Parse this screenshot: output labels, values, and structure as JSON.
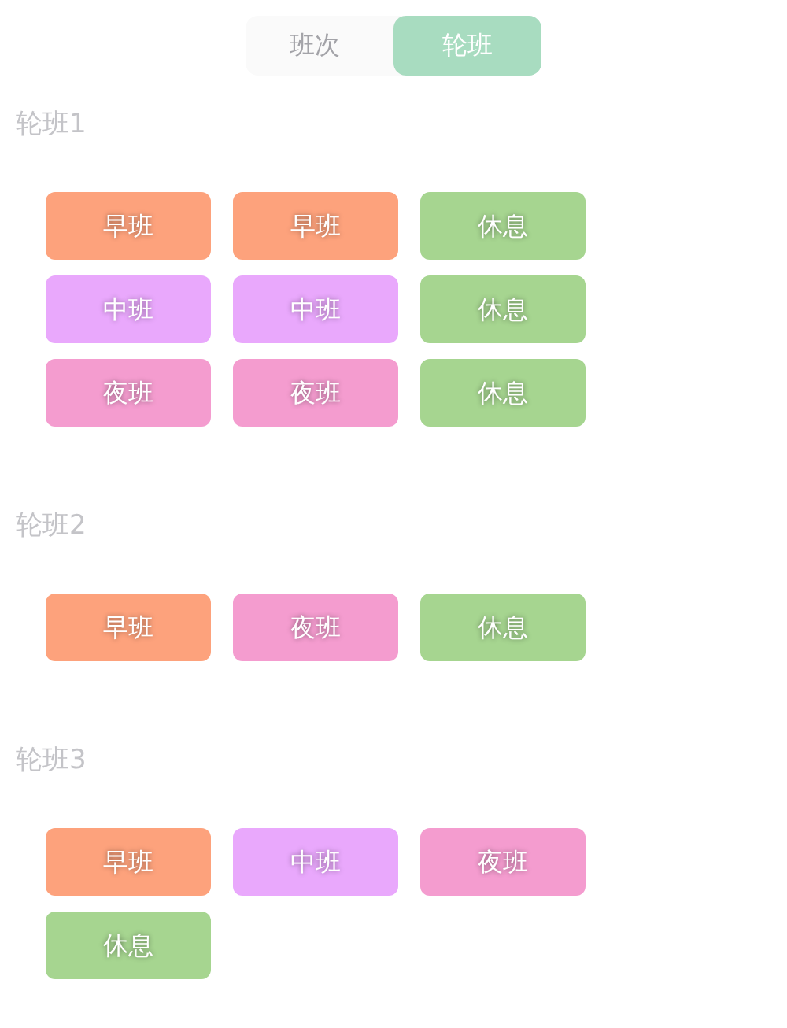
{
  "tabs": [
    {
      "label": "班次",
      "selected": false
    },
    {
      "label": "轮班",
      "selected": true
    }
  ],
  "rotations": [
    {
      "title": "轮班1",
      "shifts": [
        {
          "label": "早班",
          "color": "#fda27c"
        },
        {
          "label": "早班",
          "color": "#fda27c"
        },
        {
          "label": "休息",
          "color": "#a6d590"
        },
        {
          "label": "中班",
          "color": "#e9a8fc"
        },
        {
          "label": "中班",
          "color": "#e9a8fc"
        },
        {
          "label": "休息",
          "color": "#a6d590"
        },
        {
          "label": "夜班",
          "color": "#f49ccf"
        },
        {
          "label": "夜班",
          "color": "#f49ccf"
        },
        {
          "label": "休息",
          "color": "#a6d590"
        }
      ]
    },
    {
      "title": "轮班2",
      "shifts": [
        {
          "label": "早班",
          "color": "#fda27c"
        },
        {
          "label": "夜班",
          "color": "#f49ccf"
        },
        {
          "label": "休息",
          "color": "#a6d590"
        }
      ]
    },
    {
      "title": "轮班3",
      "shifts": [
        {
          "label": "早班",
          "color": "#fda27c"
        },
        {
          "label": "中班",
          "color": "#e9a8fc"
        },
        {
          "label": "夜班",
          "color": "#f49ccf"
        },
        {
          "label": "休息",
          "color": "#a6d590"
        }
      ]
    }
  ]
}
